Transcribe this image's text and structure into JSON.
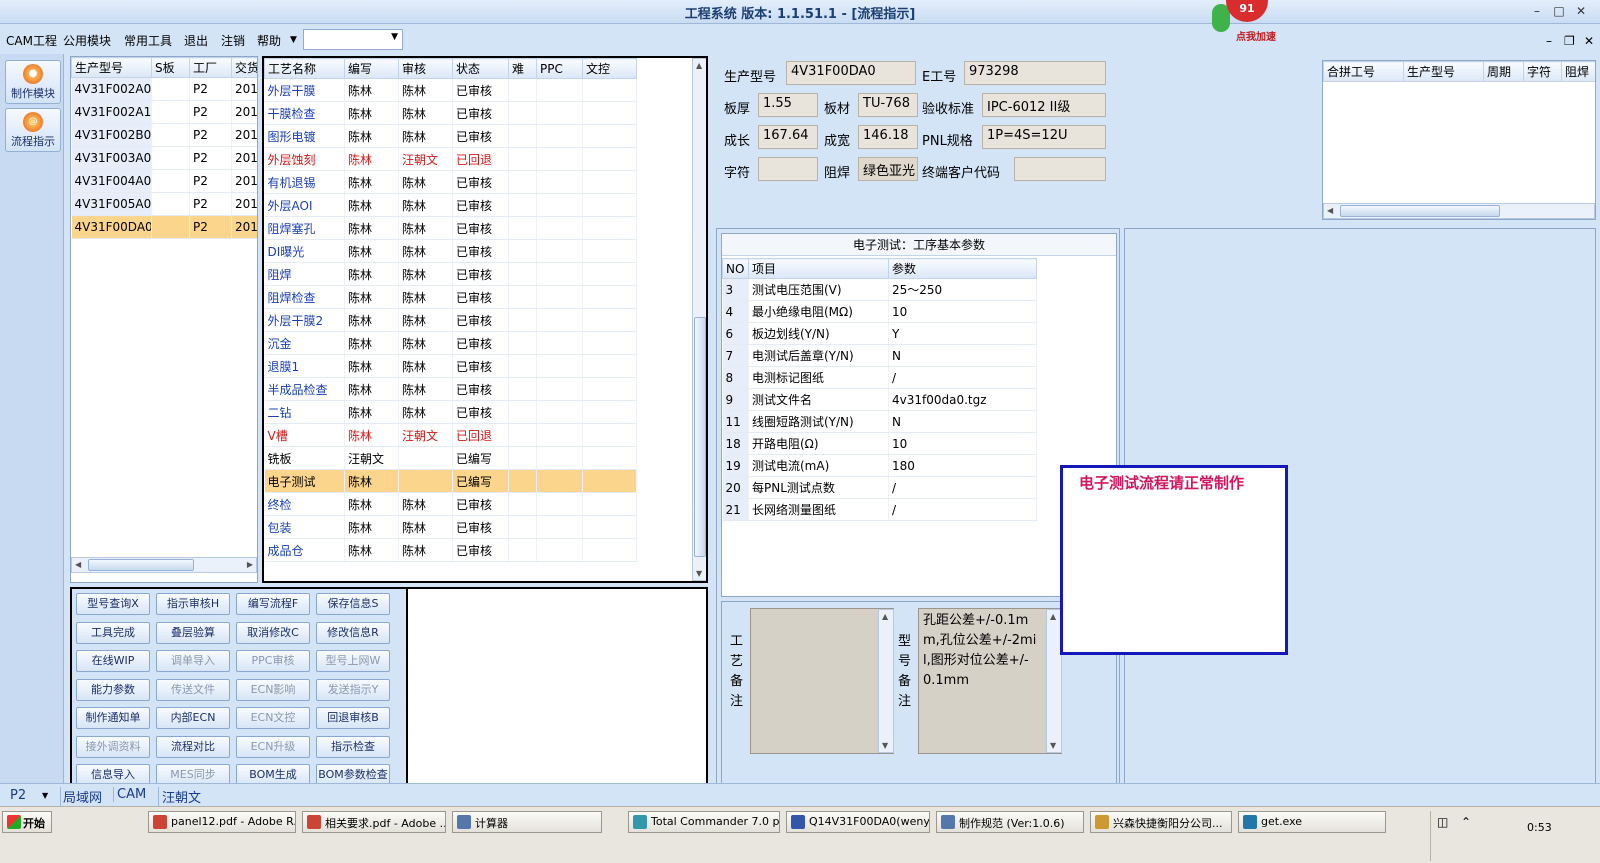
{
  "window": {
    "title": "工程系统  版本: 1.1.51.1 - [流程指示]",
    "badge": "91",
    "badge_caption": "点我加速"
  },
  "menu": {
    "items": [
      "CAM工程",
      "公用模块",
      "常用工具",
      "退出",
      "注销",
      "帮助"
    ],
    "select_value": ""
  },
  "sidebar": {
    "items": [
      {
        "label": "制作模块",
        "icon": "flame-icon"
      },
      {
        "label": "流程指示",
        "icon": "flow-icon"
      }
    ]
  },
  "model_list": {
    "columns": [
      "生产型号",
      "S板",
      "工厂",
      "交货"
    ],
    "rows": [
      [
        "4V31F002A0",
        "",
        "P2",
        "201"
      ],
      [
        "4V31F002A1",
        "",
        "P2",
        "201"
      ],
      [
        "4V31F002B0",
        "",
        "P2",
        "201"
      ],
      [
        "4V31F003A0",
        "",
        "P2",
        "201"
      ],
      [
        "4V31F004A0",
        "",
        "P2",
        "201"
      ],
      [
        "4V31F005A0",
        "",
        "P2",
        "201"
      ],
      [
        "4V31F00DA0",
        "",
        "P2",
        "201"
      ]
    ],
    "selected_index": 6
  },
  "process_list": {
    "columns": [
      "工艺名称",
      "编写",
      "审核",
      "状态",
      "难",
      "PPC",
      "文控"
    ],
    "rows": [
      {
        "cells": [
          "外层干膜",
          "陈林",
          "陈林",
          "已审核"
        ],
        "style": "blue"
      },
      {
        "cells": [
          "干膜检查",
          "陈林",
          "陈林",
          "已审核"
        ],
        "style": "blue"
      },
      {
        "cells": [
          "图形电镀",
          "陈林",
          "陈林",
          "已审核"
        ],
        "style": "blue"
      },
      {
        "cells": [
          "外层蚀刻",
          "陈林",
          "汪朝文",
          "已回退"
        ],
        "style": "red"
      },
      {
        "cells": [
          "有机退锡",
          "陈林",
          "陈林",
          "已审核"
        ],
        "style": "blue"
      },
      {
        "cells": [
          "外层AOI",
          "陈林",
          "陈林",
          "已审核"
        ],
        "style": "blue"
      },
      {
        "cells": [
          "阻焊塞孔",
          "陈林",
          "陈林",
          "已审核"
        ],
        "style": "blue"
      },
      {
        "cells": [
          "DI曝光",
          "陈林",
          "陈林",
          "已审核"
        ],
        "style": "blue"
      },
      {
        "cells": [
          "阻焊",
          "陈林",
          "陈林",
          "已审核"
        ],
        "style": "blue"
      },
      {
        "cells": [
          "阻焊检查",
          "陈林",
          "陈林",
          "已审核"
        ],
        "style": "blue"
      },
      {
        "cells": [
          "外层干膜2",
          "陈林",
          "陈林",
          "已审核"
        ],
        "style": "blue"
      },
      {
        "cells": [
          "沉金",
          "陈林",
          "陈林",
          "已审核"
        ],
        "style": "blue"
      },
      {
        "cells": [
          "退膜1",
          "陈林",
          "陈林",
          "已审核"
        ],
        "style": "blue"
      },
      {
        "cells": [
          "半成品检查",
          "陈林",
          "陈林",
          "已审核"
        ],
        "style": "blue"
      },
      {
        "cells": [
          "二钻",
          "陈林",
          "陈林",
          "已审核"
        ],
        "style": "blue"
      },
      {
        "cells": [
          "V槽",
          "陈林",
          "汪朝文",
          "已回退"
        ],
        "style": "red"
      },
      {
        "cells": [
          "铣板",
          "汪朝文",
          "",
          "已编写"
        ],
        "style": "plain"
      },
      {
        "cells": [
          "电子测试",
          "陈林",
          "",
          "已编写"
        ],
        "style": "sel"
      },
      {
        "cells": [
          "终检",
          "陈林",
          "陈林",
          "已审核"
        ],
        "style": "blue"
      },
      {
        "cells": [
          "包装",
          "陈林",
          "陈林",
          "已审核"
        ],
        "style": "blue"
      },
      {
        "cells": [
          "成品仓",
          "陈林",
          "陈林",
          "已审核"
        ],
        "style": "blue"
      }
    ]
  },
  "buttons": [
    {
      "label": "型号查询X",
      "enabled": true
    },
    {
      "label": "指示审核H",
      "enabled": true
    },
    {
      "label": "编写流程F",
      "enabled": true
    },
    {
      "label": "保存信息S",
      "enabled": true
    },
    {
      "label": "工具完成",
      "enabled": true
    },
    {
      "label": "叠层验算",
      "enabled": true
    },
    {
      "label": "取消修改C",
      "enabled": true
    },
    {
      "label": "修改信息R",
      "enabled": true
    },
    {
      "label": "在线WIP",
      "enabled": true
    },
    {
      "label": "调单导入",
      "enabled": false
    },
    {
      "label": "PPC审核",
      "enabled": false
    },
    {
      "label": "型号上网W",
      "enabled": false
    },
    {
      "label": "能力参数",
      "enabled": true
    },
    {
      "label": "传送文件",
      "enabled": false
    },
    {
      "label": "ECN影响",
      "enabled": false
    },
    {
      "label": "发送指示Y",
      "enabled": false
    },
    {
      "label": "制作通知单",
      "enabled": true
    },
    {
      "label": "内部ECN",
      "enabled": true
    },
    {
      "label": "ECN文控",
      "enabled": false
    },
    {
      "label": "回退审核B",
      "enabled": true
    },
    {
      "label": "接外调资料",
      "enabled": false
    },
    {
      "label": "流程对比",
      "enabled": true
    },
    {
      "label": "ECN升级",
      "enabled": false
    },
    {
      "label": "指示检查",
      "enabled": true
    },
    {
      "label": "信息导入",
      "enabled": true
    },
    {
      "label": "MES同步",
      "enabled": false
    },
    {
      "label": "BOM生成",
      "enabled": true
    },
    {
      "label": "BOM参数检查",
      "enabled": true
    }
  ],
  "info": {
    "model_label": "生产型号",
    "model_value": "4V31F00DA0",
    "eno_label": "E工号",
    "eno_value": "973298",
    "thick_label": "板厚",
    "thick_value": "1.55",
    "material_label": "板材",
    "material_value": "TU-768",
    "std_label": "验收标准",
    "std_value": "IPC-6012 II级",
    "len_label": "成长",
    "len_value": "167.64",
    "wid_label": "成宽",
    "wid_value": "146.18",
    "pnl_label": "PNL规格",
    "pnl_value": "1P=4S=12U",
    "char_label": "字符",
    "char_value": "",
    "mask_label": "阻焊",
    "mask_value": "绿色亚光",
    "cust_label": "终端客户代码",
    "cust_value": ""
  },
  "combined": {
    "columns": [
      "合拼工号",
      "生产型号",
      "周期",
      "字符",
      "阻焊"
    ]
  },
  "params": {
    "title": "电子测试：工序基本参数",
    "columns": [
      "NO",
      "项目",
      "参数"
    ],
    "rows": [
      [
        "3",
        "测试电压范围(V)",
        "25～250"
      ],
      [
        "4",
        "最小绝缘电阻(MΩ)",
        "10"
      ],
      [
        "6",
        "板边划线(Y/N)",
        "Y"
      ],
      [
        "7",
        "电测试后盖章(Y/N)",
        "N"
      ],
      [
        "8",
        "电测标记图纸",
        "/"
      ],
      [
        "9",
        "测试文件名",
        "4v31f00da0.tgz"
      ],
      [
        "11",
        "线圈短路测试(Y/N)",
        "N"
      ],
      [
        "18",
        "开路电阻(Ω)",
        "10"
      ],
      [
        "19",
        "测试电流(mA)",
        "180"
      ],
      [
        "20",
        "每PNL测试点数",
        "/"
      ],
      [
        "21",
        "长网络测量图纸",
        "/"
      ]
    ]
  },
  "notes": {
    "process_label": "工艺备注",
    "process_value": "",
    "model_label": "型号备注",
    "model_value": "孔距公差+/-0.1mm,孔位公差+/-2mil,图形对位公差+/-0.1mm"
  },
  "alert": {
    "text": "电子测试流程请正常制作"
  },
  "status": {
    "factory": "P2",
    "items": [
      "局域网",
      "CAM",
      "汪朝文"
    ]
  },
  "taskbar": {
    "start": "开始",
    "tasks": [
      "panel12.pdf - Adobe R...",
      "相关要求.pdf - Adobe ...",
      "计算器",
      "Total Commander 7.0 p...",
      "Q14V31F00DA0(wenyh...",
      "制作规范 (Ver:1.0.6)",
      "兴森快捷衡阳分公司...",
      "get.exe"
    ],
    "time": "0:53"
  }
}
